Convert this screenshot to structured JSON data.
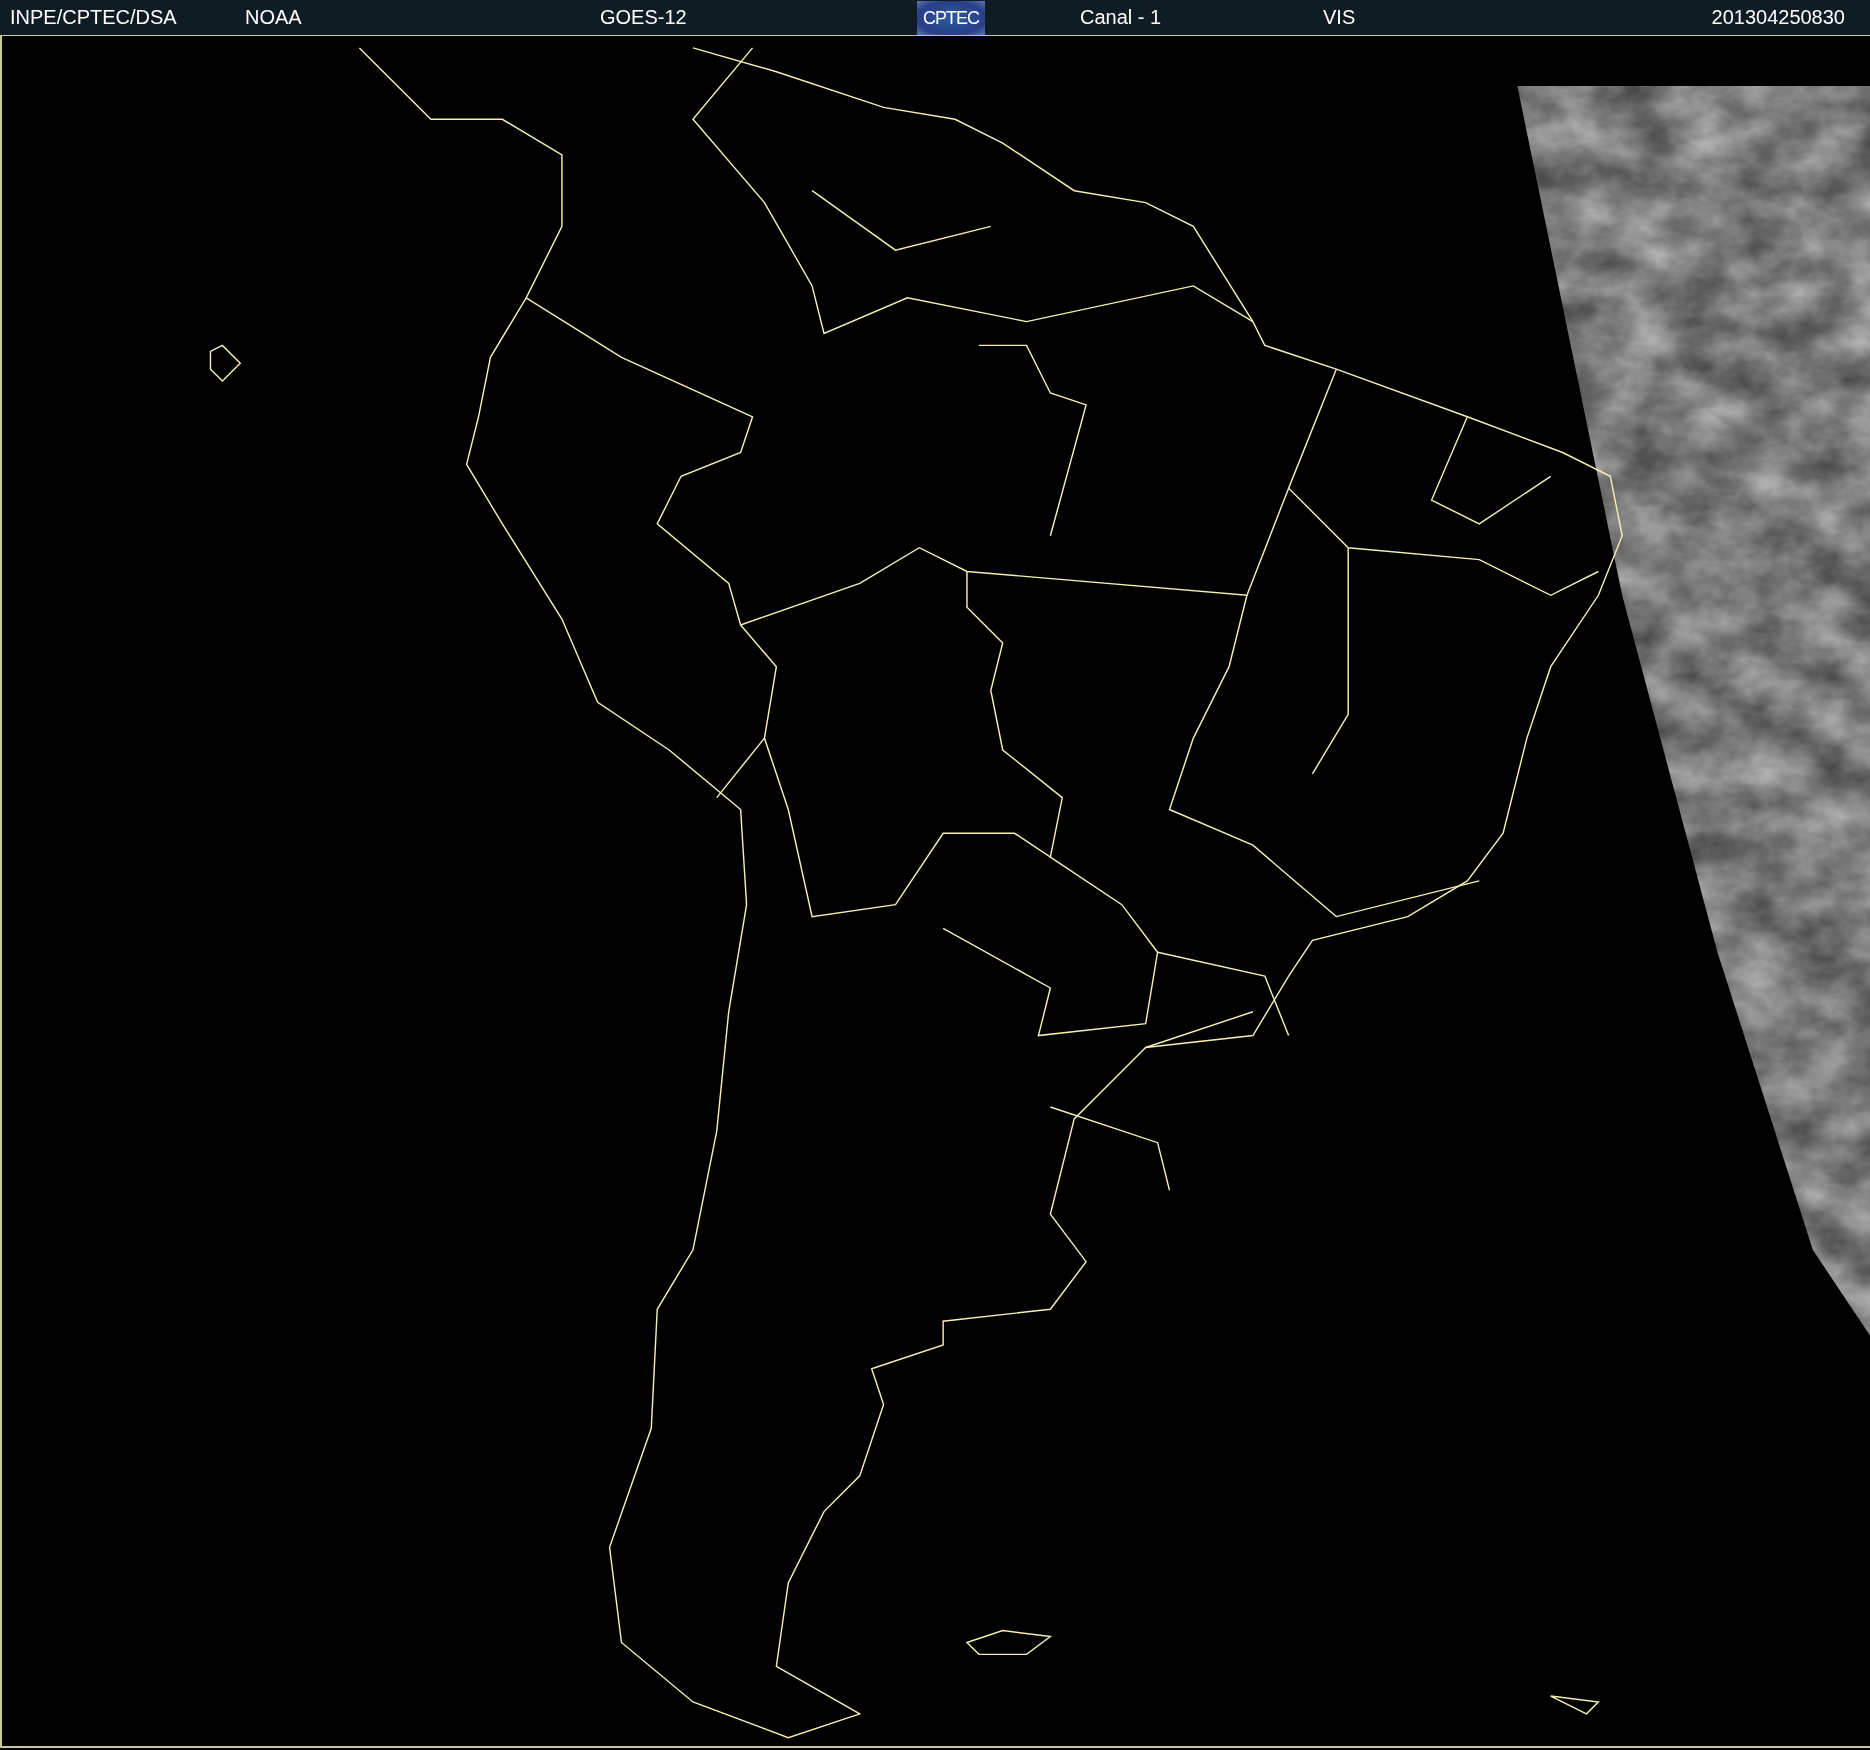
{
  "header": {
    "items": [
      {
        "kind": "text",
        "text": "INPE/CPTEC/DSA"
      },
      {
        "kind": "text",
        "text": "NOAA"
      },
      {
        "kind": "text",
        "text": "GOES-12"
      },
      {
        "kind": "logo",
        "text": "CPTEC"
      },
      {
        "kind": "text",
        "text": "Canal - 1"
      },
      {
        "kind": "text",
        "text": "VIS"
      },
      {
        "kind": "text",
        "text": "201304250830"
      }
    ]
  }
}
